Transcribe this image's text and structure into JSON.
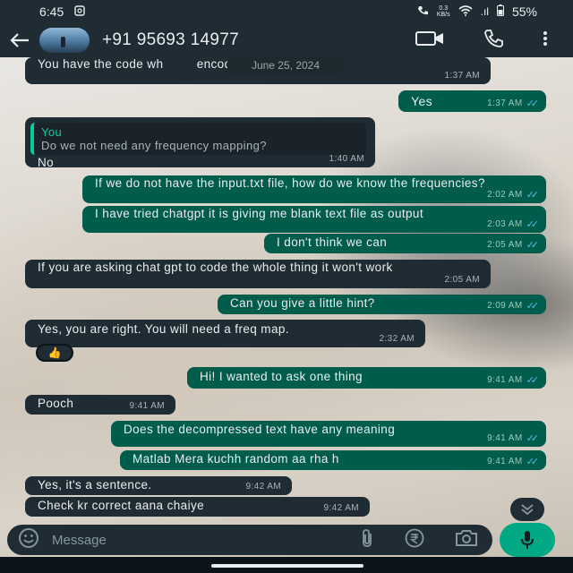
{
  "status_bar": {
    "time": "6:45",
    "net_speed_value": "0.3",
    "net_speed_unit": "KB/s",
    "signal": ".ıl",
    "battery_pct": "55%"
  },
  "header": {
    "contact_name": "+91 95693 14977",
    "icons": [
      "back-arrow-icon",
      "video-call-icon",
      "phone-icon",
      "more-options-icon"
    ]
  },
  "date_chip": "June 25, 2024",
  "messages": [
    {
      "dir": "in",
      "text": "You have the code wh         encode the text.",
      "time": "1:37 AM"
    },
    {
      "dir": "out",
      "text": "Yes",
      "time": "1:37 AM"
    },
    {
      "dir": "in",
      "quote_author": "You",
      "quote_text": "Do we not need any frequency mapping?",
      "text": "No",
      "time": "1:40 AM"
    },
    {
      "dir": "out",
      "text": "If we do not have the input.txt file, how do we know the frequencies?",
      "time": "2:02 AM"
    },
    {
      "dir": "out",
      "text": "I have tried chatgpt it is giving me blank text file as output",
      "time": "2:03 AM"
    },
    {
      "dir": "out",
      "text": "I don't think we can",
      "time": "2:05 AM"
    },
    {
      "dir": "in",
      "text": "If you are asking chat gpt to code the whole thing it won't work",
      "time": "2:05 AM"
    },
    {
      "dir": "out",
      "text": "Can you give a little hint?",
      "time": "2:09 AM"
    },
    {
      "dir": "in",
      "text": "Yes, you are right. You will need a freq map.",
      "time": "2:32 AM",
      "reaction": "👍"
    },
    {
      "dir": "out",
      "text": "Hi! I wanted to ask one thing",
      "time": "9:41 AM"
    },
    {
      "dir": "in",
      "text": "Pooch",
      "time": "9:41 AM"
    },
    {
      "dir": "out",
      "text": "Does the decompressed text have any meaning",
      "time": "9:41 AM"
    },
    {
      "dir": "out",
      "text": "Matlab Mera kuchh random aa rha h",
      "time": "9:41 AM"
    },
    {
      "dir": "in",
      "text": "Yes, it's a sentence.",
      "time": "9:42 AM"
    },
    {
      "dir": "in",
      "text": "Check kr correct aana chaiye",
      "time": "9:42 AM"
    }
  ],
  "composer": {
    "placeholder": "Message",
    "icons": [
      "emoji-icon",
      "attach-icon",
      "payment-icon",
      "camera-icon",
      "mic-icon"
    ]
  },
  "colors": {
    "incoming_bubble": "#202c33",
    "outgoing_bubble": "#005c4b",
    "read_ticks": "#53bdeb",
    "accent": "#00a884"
  }
}
